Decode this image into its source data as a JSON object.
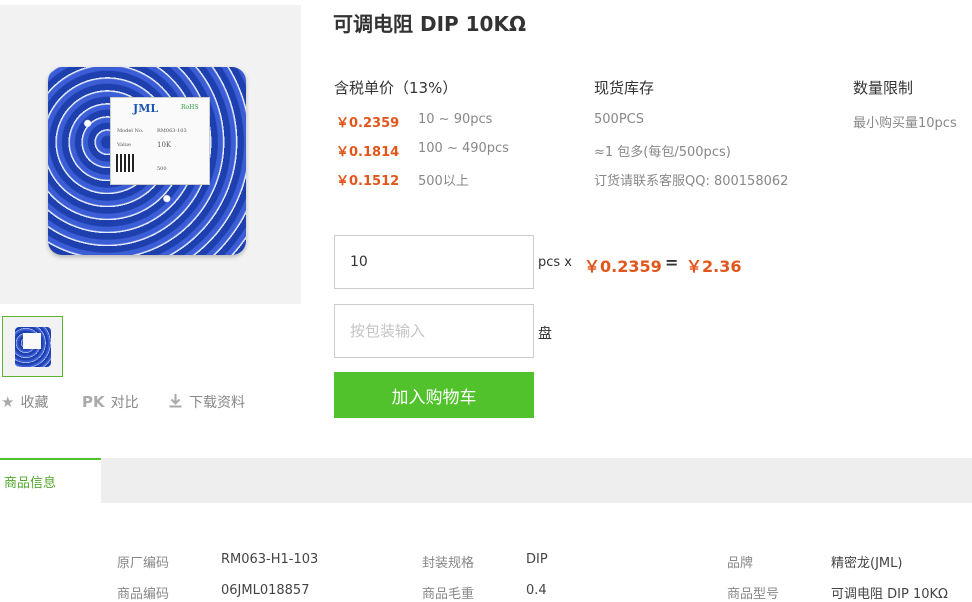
{
  "product": {
    "title": "可调电阻 DIP 10KΩ",
    "image_label": {
      "brand": "JML",
      "rohs": "RoHS",
      "model_key": "Model No.",
      "model": "RM063-103",
      "value_key": "Value",
      "value": "10K",
      "qty": "500"
    }
  },
  "actions": {
    "favorite": "收藏",
    "compare_prefix": "PK",
    "compare": "对比",
    "download": "下载资料"
  },
  "pricing": {
    "header": "含税单价（13%）",
    "tiers": [
      {
        "price": "￥0.2359",
        "range": "10 ~ 90pcs"
      },
      {
        "price": "￥0.1814",
        "range": "100 ~ 490pcs"
      },
      {
        "price": "￥0.1512",
        "range": "500以上"
      }
    ]
  },
  "stock": {
    "header": "现货库存",
    "lines": [
      "500PCS",
      "≈1 包多(每包/500pcs)",
      "订货请联系客服QQ: 800158062"
    ]
  },
  "limit": {
    "header": "数量限制",
    "min": "最小购买量10pcs"
  },
  "order": {
    "quantity_value": "10",
    "unit": "pcs x",
    "unit_price": "￥0.2359",
    "equals": "=",
    "total": "￥2.36",
    "package_placeholder": "按包装输入",
    "package_unit": "盘",
    "add_to_cart": "加入购物车"
  },
  "tabs": {
    "info": "商品信息"
  },
  "specs": [
    {
      "key": "原厂编码",
      "value": "RM063-H1-103"
    },
    {
      "key": "封装规格",
      "value": "DIP"
    },
    {
      "key": "品牌",
      "value": "精密龙(JML)"
    },
    {
      "key": "商品编码",
      "value": "06JML018857"
    },
    {
      "key": "商品毛重",
      "value": "0.4"
    },
    {
      "key": "商品型号",
      "value": "可调电阻 DIP 10KΩ"
    }
  ],
  "colors": {
    "accent_green": "#52c22c",
    "price_orange": "#e1561b"
  }
}
